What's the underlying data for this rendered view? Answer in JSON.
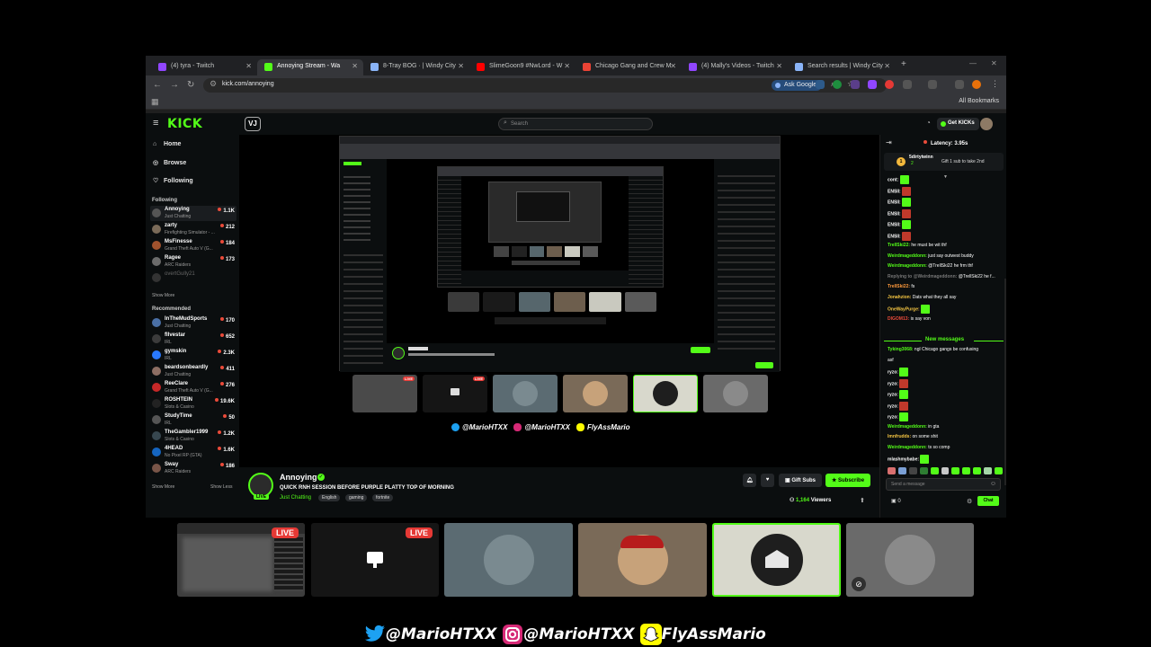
{
  "browser": {
    "tabs": [
      {
        "label": "(4) tyra - Twitch",
        "active": false,
        "color": "#9146ff"
      },
      {
        "label": "Annoying Stream - Wa",
        "active": true,
        "color": "#53fc18"
      },
      {
        "label": "8-Tray BOG · | Windy City",
        "active": false,
        "color": "#8ab4f8"
      },
      {
        "label": "SlimeGoon9 #NwLord - W",
        "active": false,
        "color": "#ff0000"
      },
      {
        "label": "Chicago Gang and Crew M",
        "active": false,
        "color": "#ea4335"
      },
      {
        "label": "(4) Mally's Videos - Twitch",
        "active": false,
        "color": "#9146ff"
      },
      {
        "label": "Search results | Windy City",
        "active": false,
        "color": "#8ab4f8"
      }
    ],
    "url": "kick.com/annoying",
    "ask_google": "Ask Google",
    "all_bookmarks": "All Bookmarks"
  },
  "kick": {
    "logo": "KICK",
    "search_placeholder": "Search",
    "get_kicks": "Get KICKs",
    "nav": [
      {
        "label": "Home",
        "icon": "home-icon"
      },
      {
        "label": "Browse",
        "icon": "compass-icon"
      },
      {
        "label": "Following",
        "icon": "heart-icon"
      }
    ],
    "following_heading": "Following",
    "following": [
      {
        "name": "Annoying",
        "category": "Just Chatting",
        "viewers": "1.1K",
        "color": "#555"
      },
      {
        "name": "zarty",
        "category": "Firefighting Simulator - ...",
        "viewers": "212",
        "color": "#7a6a58"
      },
      {
        "name": "MsFinesse",
        "category": "Grand Theft Auto V (G...",
        "viewers": "184",
        "color": "#a0522d"
      },
      {
        "name": "Ragee",
        "category": "ARC Raiders",
        "viewers": "173",
        "color": "#6b6b6b"
      },
      {
        "name": "overtGully21",
        "category": "",
        "viewers": "",
        "color": "#333"
      }
    ],
    "show_more_1": "Show More",
    "recommended_heading": "Recommended",
    "recommended": [
      {
        "name": "InTheMudSports",
        "category": "Just Chatting",
        "viewers": "170",
        "color": "#4a6fa5"
      },
      {
        "name": "fllvestar",
        "category": "IRL",
        "viewers": "652",
        "color": "#3b3b3b"
      },
      {
        "name": "gymskin",
        "category": "IRL",
        "viewers": "2.3K",
        "color": "#2979ff"
      },
      {
        "name": "beardsonbeardly",
        "category": "Just Chatting",
        "viewers": "411",
        "color": "#8d6e63"
      },
      {
        "name": "ReeClare",
        "category": "Grand Theft Auto V (G...",
        "viewers": "276",
        "color": "#c62828"
      },
      {
        "name": "ROSHTEIN",
        "category": "Slots & Casino",
        "viewers": "19.6K",
        "color": "#222"
      },
      {
        "name": "StudyTime",
        "category": "IRL",
        "viewers": "50",
        "color": "#555"
      },
      {
        "name": "TheGambler1999",
        "category": "Slots & Casino",
        "viewers": "1.2K",
        "color": "#37474f"
      },
      {
        "name": "4HEAD",
        "category": "No Pixel RP (GTA)",
        "viewers": "1.6K",
        "color": "#1565c0"
      },
      {
        "name": "Sway",
        "category": "ARC Raiders",
        "viewers": "186",
        "color": "#795548"
      }
    ],
    "show_more_2": "Show More",
    "show_less": "Show Less"
  },
  "stream": {
    "name": "Annoying",
    "title": "QUICK RNH SESSION BEFORE PURPLE PLATTY TOP OF MORNING",
    "category": "Just Chatting",
    "tags": [
      "English",
      "gaming",
      "fortnite"
    ],
    "live": "LIVE",
    "gift_subs": "Gift Subs",
    "subscribe": "Subscribe",
    "viewers": "1,164",
    "viewers_label": "Viewers"
  },
  "chat": {
    "latency": "Latency: 3.95s",
    "pinned_user": "5dirtytwinn",
    "pinned_sub": "2",
    "pinned_text": "Gift 1 sub to take 2nd",
    "messages": [
      {
        "user": "cont:",
        "text": "",
        "color": "#ffffff",
        "emote": true
      },
      {
        "user": "ENSII:",
        "text": "",
        "color": "#ffffff",
        "emote": true
      },
      {
        "user": "ENSII:",
        "text": "",
        "color": "#ffffff",
        "emote": true
      },
      {
        "user": "ENSII:",
        "text": "",
        "color": "#ffffff",
        "emote": true
      },
      {
        "user": "ENSII:",
        "text": "",
        "color": "#ffffff",
        "emote": true
      },
      {
        "user": "ENSII:",
        "text": "",
        "color": "#ffffff",
        "emote": true
      },
      {
        "user": "TrellSki22:",
        "text": "he must be wit thf",
        "color": "#53fc18",
        "emote": false
      },
      {
        "user": "Weirdmageddonn:",
        "text": "just say outwest buddy",
        "color": "#53fc18",
        "emote": false
      },
      {
        "user": "Weirdmageddonn:",
        "text": "@TrellSki22 he frm thf",
        "color": "#53fc18",
        "emote": false
      },
      {
        "user": "Replying to @Weirdmageddonn:",
        "text": "@TrellSki22 he f...",
        "color": "#777777",
        "emote": false
      },
      {
        "user": "TrellSki22:",
        "text": "fs",
        "color": "#ff9a3c",
        "emote": false
      },
      {
        "user": "Jonahzion:",
        "text": "Dats what they all say",
        "color": "#f5c542",
        "emote": false
      },
      {
        "user": "OneWayPurge:",
        "text": "",
        "color": "#f5c542",
        "emote": true
      },
      {
        "user": "DIGOM13:",
        "text": "is say von",
        "color": "#ea4b3a",
        "emote": false
      }
    ],
    "new_messages": "New messages",
    "messages2": [
      {
        "user": "Tyking3068:",
        "text": "ngl Chicago gangs be confusing",
        "color": "#53fc18",
        "emote": false
      },
      {
        "user": "",
        "text": "asf",
        "color": "#53fc18",
        "emote": false
      },
      {
        "user": "ryzo:",
        "text": "",
        "color": "#ffffff",
        "emote": true
      },
      {
        "user": "ryzo:",
        "text": "",
        "color": "#ffffff",
        "emote": true
      },
      {
        "user": "ryzo:",
        "text": "",
        "color": "#ffffff",
        "emote": true
      },
      {
        "user": "ryzo:",
        "text": "",
        "color": "#ffffff",
        "emote": true
      },
      {
        "user": "ryzo:",
        "text": "",
        "color": "#ffffff",
        "emote": true
      },
      {
        "user": "Weirdmageddonn:",
        "text": "in gta",
        "color": "#53fc18",
        "emote": false
      },
      {
        "user": "lmnfrudds:",
        "text": "on some shit",
        "color": "#f5c542",
        "emote": false
      },
      {
        "user": "Weirdmageddonn:",
        "text": "ts so comp",
        "color": "#53fc18",
        "emote": false
      },
      {
        "user": "mlashmybabe:",
        "text": "",
        "color": "#ffffff",
        "emote": true
      }
    ],
    "input_placeholder": "Send a message",
    "points": "0",
    "send": "Chat"
  },
  "cams": [
    {
      "kind": "screen",
      "live": "LIVE"
    },
    {
      "kind": "monitor",
      "live": "LIVE"
    },
    {
      "kind": "avatar",
      "bg": "#5b6b72",
      "circle": "#7a8a90"
    },
    {
      "kind": "avatar",
      "bg": "#7a6a58",
      "circle": "#c7a27a"
    },
    {
      "kind": "avatar",
      "bg": "#d8d8cc",
      "circle": "#1e1e1e"
    },
    {
      "kind": "avatar",
      "bg": "#6a6a6a",
      "circle": "#8a8a8a"
    }
  ],
  "socials": [
    {
      "icon": "twitter-icon",
      "handle": "@MarioHTXX",
      "color": "#1da1f2"
    },
    {
      "icon": "instagram-icon",
      "handle": "@MarioHTXX",
      "color": "#d62976"
    },
    {
      "icon": "snapchat-icon",
      "handle": "FlyAssMario",
      "color": "#fffc00"
    }
  ]
}
